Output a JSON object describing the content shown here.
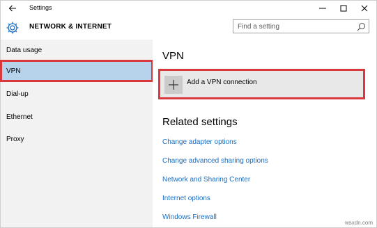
{
  "window": {
    "title": "Settings",
    "back_icon": "back-arrow-icon",
    "controls": [
      "minimize-icon",
      "maximize-icon",
      "close-icon"
    ]
  },
  "header": {
    "icon": "gear-icon",
    "section_title": "NETWORK & INTERNET",
    "search": {
      "placeholder": "Find a setting",
      "value": "",
      "icon": "search-icon"
    }
  },
  "sidebar": {
    "items": [
      {
        "label": "Data usage",
        "selected": false
      },
      {
        "label": "VPN",
        "selected": true
      },
      {
        "label": "Dial-up",
        "selected": false
      },
      {
        "label": "Ethernet",
        "selected": false
      },
      {
        "label": "Proxy",
        "selected": false
      }
    ]
  },
  "main": {
    "heading": "VPN",
    "add_vpn": {
      "label": "Add a VPN connection",
      "icon": "plus-icon"
    },
    "related": {
      "heading": "Related settings",
      "links": [
        "Change adapter options",
        "Change advanced sharing options",
        "Network and Sharing Center",
        "Internet options",
        "Windows Firewall"
      ]
    }
  },
  "watermark": "wsxdn.com",
  "colors": {
    "selected_bg": "#b7d3ec",
    "highlight_border": "#d9383d",
    "link": "#1a6fc4",
    "sidebar_bg": "#f2f2f2"
  }
}
